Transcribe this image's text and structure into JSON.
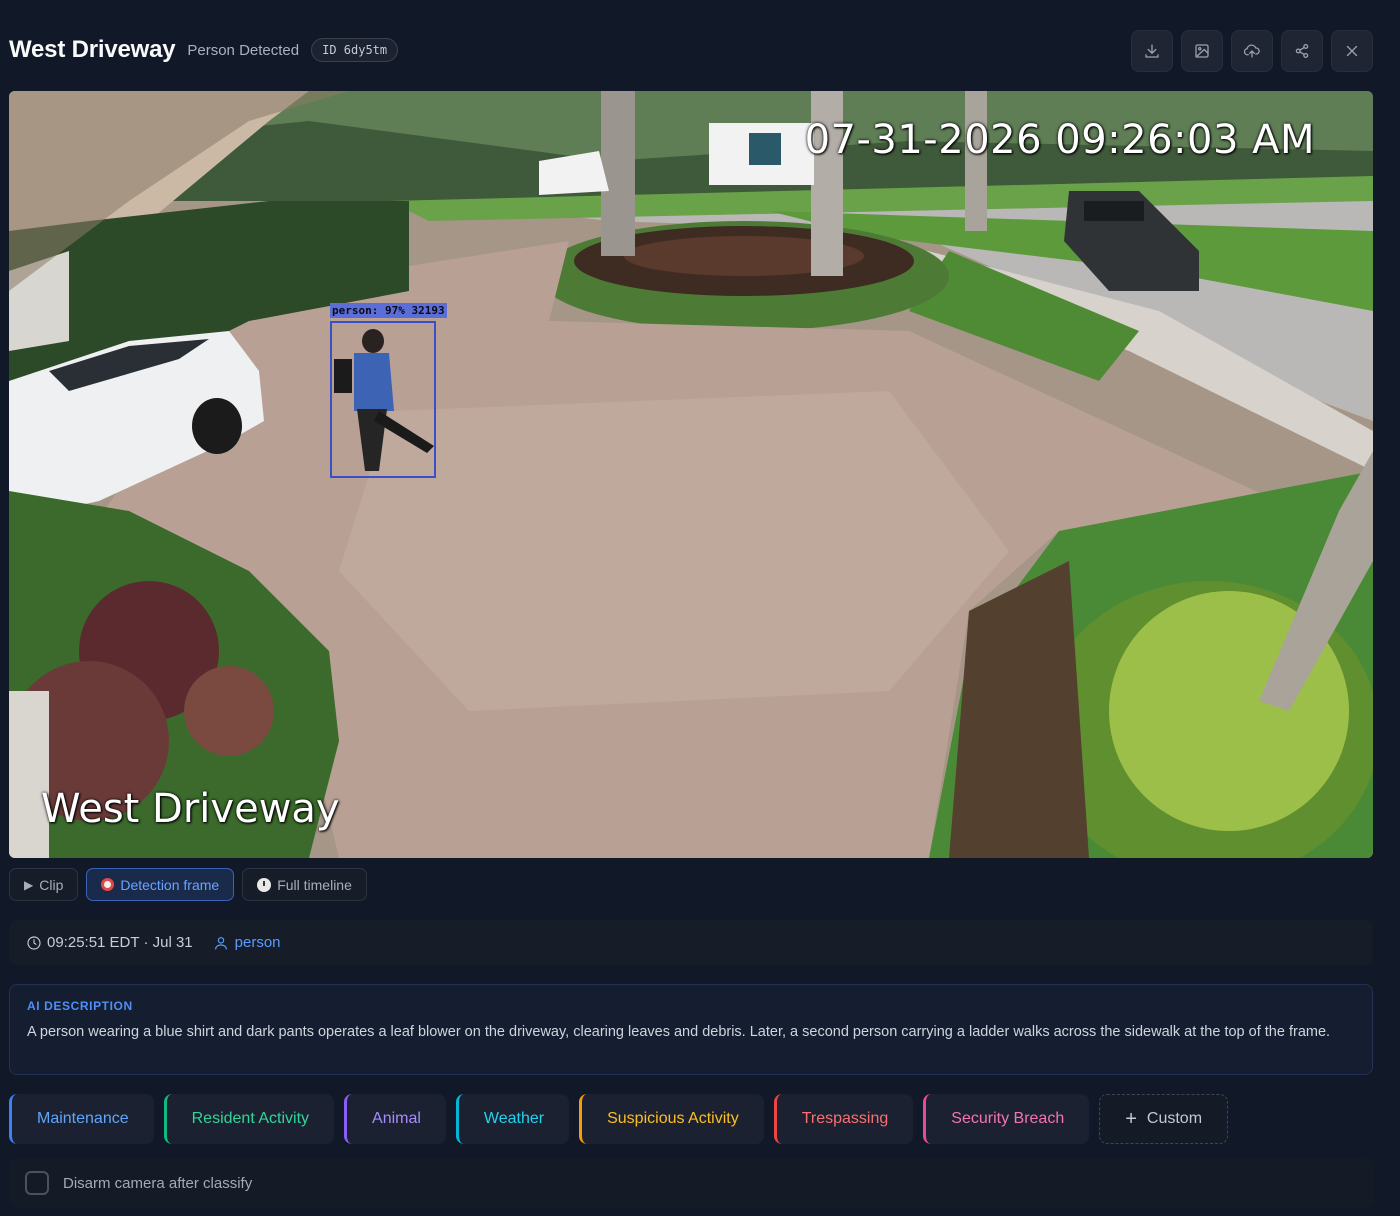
{
  "header": {
    "title": "West Driveway",
    "event_type": "Person Detected",
    "event_id": "ID 6dy5tm",
    "actions": [
      {
        "icon": "download-icon"
      },
      {
        "icon": "image-icon"
      },
      {
        "icon": "cloud-upload-icon"
      },
      {
        "icon": "share-icon"
      },
      {
        "icon": "close-icon"
      }
    ]
  },
  "video": {
    "osd_timestamp": "07-31-2026 09:26:03 AM",
    "osd_camera_name": "West Driveway",
    "detection_label": "person: 97% 32193"
  },
  "view_tabs": {
    "clip": "Clip",
    "detection_frame": "Detection frame",
    "full_timeline": "Full timeline",
    "active": "detection_frame"
  },
  "meta": {
    "time": "09:25:51 EDT · Jul 31",
    "object": "person"
  },
  "ai": {
    "label": "AI DESCRIPTION",
    "description": "A person wearing a blue shirt and dark pants operates a leaf blower on the driveway, clearing leaves and debris. Later, a second person carrying a ladder walks across the sidewalk at the top of the frame."
  },
  "classifications": [
    {
      "label": "Maintenance",
      "color": "#3b82f6",
      "text": "#60a5fa"
    },
    {
      "label": "Resident Activity",
      "color": "#10b981",
      "text": "#34d399"
    },
    {
      "label": "Animal",
      "color": "#8b5cf6",
      "text": "#a78bfa"
    },
    {
      "label": "Weather",
      "color": "#06b6d4",
      "text": "#22d3ee"
    },
    {
      "label": "Suspicious Activity",
      "color": "#f59e0b",
      "text": "#fbbf24"
    },
    {
      "label": "Trespassing",
      "color": "#ef4444",
      "text": "#f87171"
    },
    {
      "label": "Security Breach",
      "color": "#ec4899",
      "text": "#f472b6"
    }
  ],
  "custom_label": "Custom",
  "disarm": {
    "label": "Disarm camera after classify",
    "checked": false
  }
}
